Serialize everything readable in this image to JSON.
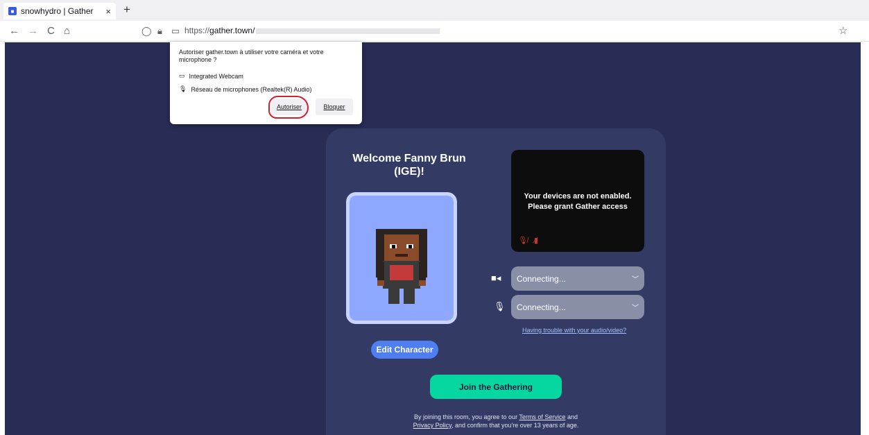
{
  "browser": {
    "tab_title": "snowhydro | Gather",
    "tab_close": "×",
    "new_tab": "+",
    "url_prefix": "https://",
    "url_host": "gather.town/",
    "back_icon": "←",
    "forward_icon": "→",
    "reload_icon": "C",
    "home_icon": "⌂",
    "star_icon": "☆"
  },
  "permission_popup": {
    "question": "Autoriser gather.town à utiliser votre caméra et votre microphone ?",
    "camera_device": "Integrated Webcam",
    "microphone_device": "Réseau de microphones (Realtek(R) Audio)",
    "allow_label": "Autoriser",
    "block_label": "Bloquer"
  },
  "card": {
    "welcome": "Welcome Fanny Brun (IGE)!",
    "edit_character": "Edit Character",
    "video_message_line1": "Your devices are not enabled.",
    "video_message_line2": "Please grant Gather access",
    "camera_select": "Connecting...",
    "microphone_select": "Connecting...",
    "trouble_link": "Having trouble with your audio/video?",
    "join_button": "Join the Gathering",
    "legal_prefix": "By joining this room, you agree to our",
    "terms_link": "Terms of Service",
    "legal_and": "and",
    "privacy_link": "Privacy Policy",
    "legal_suffix": ", and confirm that you're over 13 years of age."
  },
  "colors": {
    "page_bg": "#272d55",
    "card_bg": "#333a64",
    "join_green": "#06d6a0",
    "edit_blue": "#4e7ef0",
    "annotation_red": "#d0202a"
  }
}
